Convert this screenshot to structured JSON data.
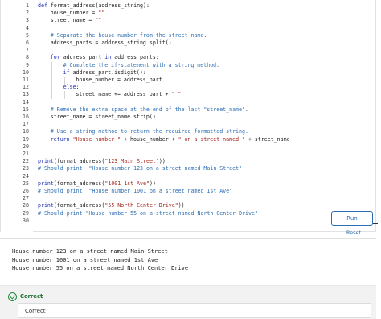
{
  "editor": {
    "lines": [
      {
        "n": "1",
        "indent": 0,
        "parts": [
          {
            "t": "def ",
            "c": "kw"
          },
          {
            "t": "format_address(address_string):",
            "c": ""
          }
        ]
      },
      {
        "n": "2",
        "indent": 1,
        "parts": [
          {
            "t": "house_number = ",
            "c": ""
          },
          {
            "t": "\"\"",
            "c": "str"
          }
        ]
      },
      {
        "n": "3",
        "indent": 1,
        "parts": [
          {
            "t": "street_name = ",
            "c": ""
          },
          {
            "t": "\"\"",
            "c": "str"
          }
        ]
      },
      {
        "n": "4",
        "indent": 0,
        "parts": []
      },
      {
        "n": "5",
        "indent": 1,
        "parts": [
          {
            "t": "# Separate the house number from the street name.",
            "c": "cm"
          }
        ]
      },
      {
        "n": "6",
        "indent": 1,
        "parts": [
          {
            "t": "address_parts = address_string.split()",
            "c": ""
          }
        ]
      },
      {
        "n": "7",
        "indent": 0,
        "parts": []
      },
      {
        "n": "8",
        "indent": 1,
        "parts": [
          {
            "t": "for ",
            "c": "kw"
          },
          {
            "t": "address_part ",
            "c": ""
          },
          {
            "t": "in ",
            "c": "kw"
          },
          {
            "t": "address_parts:",
            "c": ""
          }
        ]
      },
      {
        "n": "9",
        "indent": 2,
        "parts": [
          {
            "t": "# Complete the if-statement with a string method.",
            "c": "cm"
          }
        ]
      },
      {
        "n": "10",
        "indent": 2,
        "parts": [
          {
            "t": "if ",
            "c": "kw"
          },
          {
            "t": "address_part.isdigit():",
            "c": ""
          }
        ]
      },
      {
        "n": "11",
        "indent": 3,
        "parts": [
          {
            "t": "house_number = address_part",
            "c": ""
          }
        ]
      },
      {
        "n": "12",
        "indent": 2,
        "parts": [
          {
            "t": "else",
            "c": "kw"
          },
          {
            "t": ":",
            "c": ""
          }
        ]
      },
      {
        "n": "13",
        "indent": 3,
        "parts": [
          {
            "t": "street_name += address_part + ",
            "c": ""
          },
          {
            "t": "\" \"",
            "c": "str"
          }
        ]
      },
      {
        "n": "14",
        "indent": 0,
        "parts": []
      },
      {
        "n": "15",
        "indent": 1,
        "parts": [
          {
            "t": "# Remove the extra space at the end of the last \"street_name\".",
            "c": "cm"
          }
        ]
      },
      {
        "n": "16",
        "indent": 1,
        "parts": [
          {
            "t": "street_name = street_name.strip()",
            "c": ""
          }
        ]
      },
      {
        "n": "17",
        "indent": 0,
        "parts": []
      },
      {
        "n": "18",
        "indent": 1,
        "parts": [
          {
            "t": "# Use a string method to return the required formatted string.",
            "c": "cm"
          }
        ]
      },
      {
        "n": "19",
        "indent": 1,
        "parts": [
          {
            "t": "return ",
            "c": "kw"
          },
          {
            "t": "\"House number \"",
            "c": "str"
          },
          {
            "t": " + house_number + ",
            "c": ""
          },
          {
            "t": "\" on a street named \"",
            "c": "str"
          },
          {
            "t": " + street_name",
            "c": ""
          }
        ]
      },
      {
        "n": "20",
        "indent": 0,
        "parts": []
      },
      {
        "n": "21",
        "indent": 0,
        "parts": []
      },
      {
        "n": "22",
        "indent": 0,
        "parts": [
          {
            "t": "print",
            "c": "kw"
          },
          {
            "t": "(format_address(",
            "c": ""
          },
          {
            "t": "\"123 Main Street\"",
            "c": "str"
          },
          {
            "t": "))",
            "c": ""
          }
        ]
      },
      {
        "n": "23",
        "indent": 0,
        "parts": [
          {
            "t": "# Should print: \"House number 123 on a street named Main Street\"",
            "c": "cm"
          }
        ]
      },
      {
        "n": "24",
        "indent": 0,
        "parts": []
      },
      {
        "n": "25",
        "indent": 0,
        "parts": [
          {
            "t": "print",
            "c": "kw"
          },
          {
            "t": "(format_address(",
            "c": ""
          },
          {
            "t": "\"1001 1st Ave\"",
            "c": "str"
          },
          {
            "t": "))",
            "c": ""
          }
        ]
      },
      {
        "n": "26",
        "indent": 0,
        "parts": [
          {
            "t": "# Should print: \"House number 1001 on a street named 1st Ave\"",
            "c": "cm"
          }
        ]
      },
      {
        "n": "27",
        "indent": 0,
        "parts": []
      },
      {
        "n": "28",
        "indent": 0,
        "parts": [
          {
            "t": "print",
            "c": "kw"
          },
          {
            "t": "(format_address(",
            "c": ""
          },
          {
            "t": "\"55 North Center Drive\"",
            "c": "str"
          },
          {
            "t": "))",
            "c": ""
          }
        ]
      },
      {
        "n": "29",
        "indent": 0,
        "parts": [
          {
            "t": "# Should print \"House number 55 on a street named North Center Drive\"",
            "c": "cm"
          }
        ]
      },
      {
        "n": "30",
        "indent": 0,
        "parts": []
      }
    ]
  },
  "buttons": {
    "run_label": "Run",
    "reset_label": "Reset"
  },
  "output": {
    "lines": [
      "House number 123 on a street named Main Street",
      "House number 1001 on a street named 1st Ave",
      "House number 55 on a street named North Center Drive"
    ]
  },
  "result": {
    "status": "Correct",
    "feedback": "Correct",
    "icon": "check-circle-icon",
    "color": "#1e8e3e"
  }
}
